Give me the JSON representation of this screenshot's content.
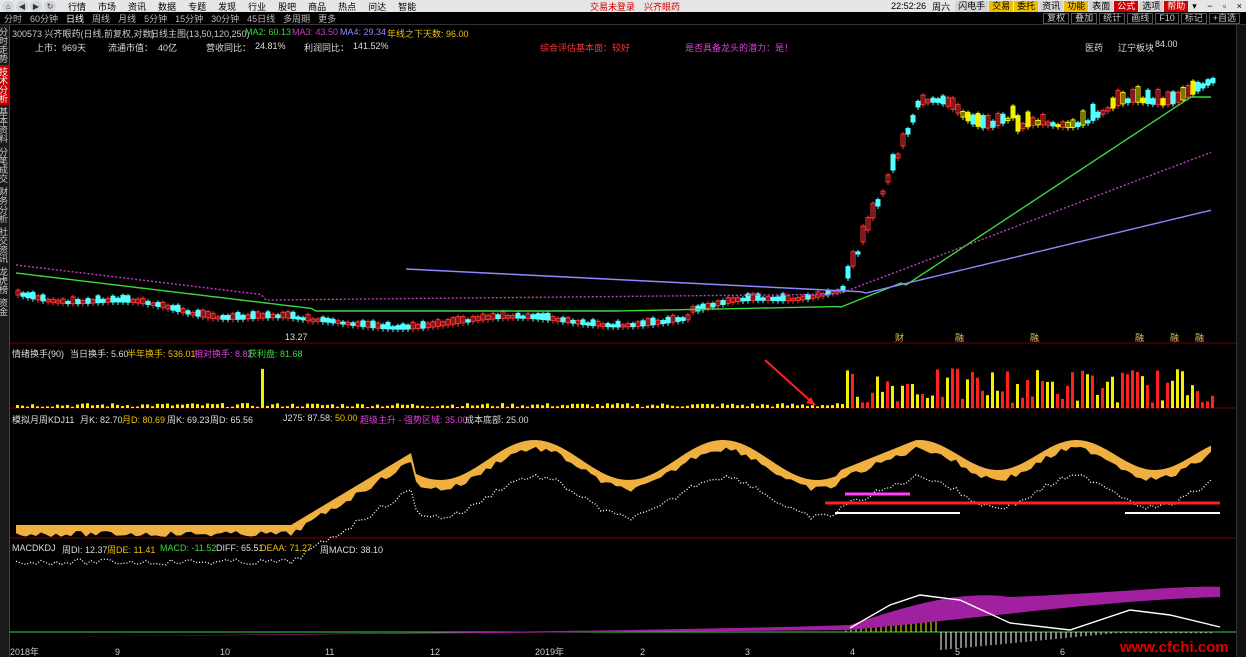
{
  "topbar": {
    "menu": [
      "行情",
      "市场",
      "资讯",
      "数据",
      "专题",
      "发现",
      "行业",
      "股吧",
      "商品",
      "热点",
      "问达",
      "智能"
    ],
    "alert": "交易未登录　兴齐眼药",
    "time": "22:52:26",
    "weekday": "周六",
    "buttons": [
      "闪电手",
      "交易",
      "委托",
      "资讯",
      "功能",
      "表面",
      "公式",
      "选项",
      "帮助"
    ]
  },
  "periods": [
    "分时",
    "60分钟",
    "日线",
    "周线",
    "月线",
    "5分钟",
    "15分钟",
    "30分钟",
    "45日线",
    "多周期",
    "更多"
  ],
  "active_period": "日线",
  "chart_buttons": [
    "复权",
    "叠加",
    "统计",
    "画线",
    "F10",
    "标记",
    "+自选"
  ],
  "sidebar_tabs": [
    "分时走势",
    "技术分析",
    "基本资料",
    "分笔成交",
    "财务分析",
    "社交资讯",
    "龙虎榜",
    "资金"
  ],
  "main_chart": {
    "stock": "300573 兴齐眼药(日线,前复权,对数)",
    "indicator": "日线主图(13,50,120,250)",
    "ma2": "MA2: 60.13",
    "ma3": "MA3: 43.50",
    "ma4": "MA4: 29.34",
    "extra": "年线之下天数: 96.00",
    "listed": "上市：969天",
    "mktcap_label": "流通市值：",
    "mktcap": "40亿",
    "rev_label": "营收同比：",
    "rev": "24.81%",
    "profit_label": "利润同比：",
    "profit": "141.52%",
    "eval": "综合评估基本面：较好",
    "leader": "是否具备龙头的潜力：是！",
    "industry": "医药",
    "area": "辽宁板块",
    "high": "84.00",
    "low": "13.27",
    "events": [
      "财",
      "融",
      "融",
      "融",
      "融",
      "融"
    ]
  },
  "panel1": {
    "title": "情绪换手(90)",
    "today": "当日换手: 5.60",
    "half": "半年换手: 536.01",
    "relative": "相对换手: 8.82",
    "profit": "获利盘: 81.68"
  },
  "panel2": {
    "title": "模拟月周KDJ11",
    "k": "月K: 82.70",
    "d": "月D: 80.69",
    "wk": "周K: 69.23",
    "wd": "周D: 65.56",
    "j": "J275: 87.58",
    "v50": ": 50.00",
    "zone": "超级主升 - 强势区域: 35.00",
    "cost": "成本底部: 25.00"
  },
  "panel3": {
    "title": "MACDKDJ",
    "di": "周DI: 12.37",
    "de": "周DE: 11.41",
    "macd": "MACD: -11.52",
    "diff": "DIFF: 65.51",
    "deaa": "DEAA: 71.27",
    "wmacd": "周MACD: 38.10"
  },
  "xaxis": [
    "2018年",
    "9",
    "10",
    "11",
    "12",
    "2019年",
    "2",
    "3",
    "4",
    "5",
    "6"
  ],
  "watermark": "www.cfchi.com",
  "colors": {
    "up": "#ff3232",
    "down": "#54ffff",
    "ma13": "#ffffff",
    "ma50": "#3ad83a",
    "ma120": "#c040c0",
    "ma250": "#8a8aff"
  }
}
